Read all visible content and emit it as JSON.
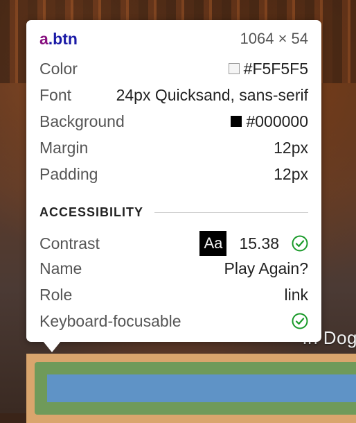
{
  "background": {
    "caption": "In Dog"
  },
  "tooltip": {
    "selector_tag": "a",
    "selector_class": ".btn",
    "dimensions": "1064 × 54",
    "rows": [
      {
        "label": "Color",
        "value": "#F5F5F5",
        "swatch_color": "#F5F5F5"
      },
      {
        "label": "Font",
        "value": "24px Quicksand, sans-serif"
      },
      {
        "label": "Background",
        "value": "#000000",
        "swatch_color": "#000000"
      },
      {
        "label": "Margin",
        "value": "12px"
      },
      {
        "label": "Padding",
        "value": "12px"
      }
    ],
    "accessibility": {
      "heading": "ACCESSIBILITY",
      "contrast_label": "Contrast",
      "contrast_sample": "Aa",
      "contrast_value": "15.38",
      "name_label": "Name",
      "name_value": "Play Again?",
      "role_label": "Role",
      "role_value": "link",
      "keyboard_label": "Keyboard-focusable"
    }
  },
  "colors": {
    "check_green": "#1a9a2a",
    "highlight_margin": "#d9a56d",
    "highlight_border": "#6f9a5a",
    "highlight_content": "#5f93c6"
  }
}
